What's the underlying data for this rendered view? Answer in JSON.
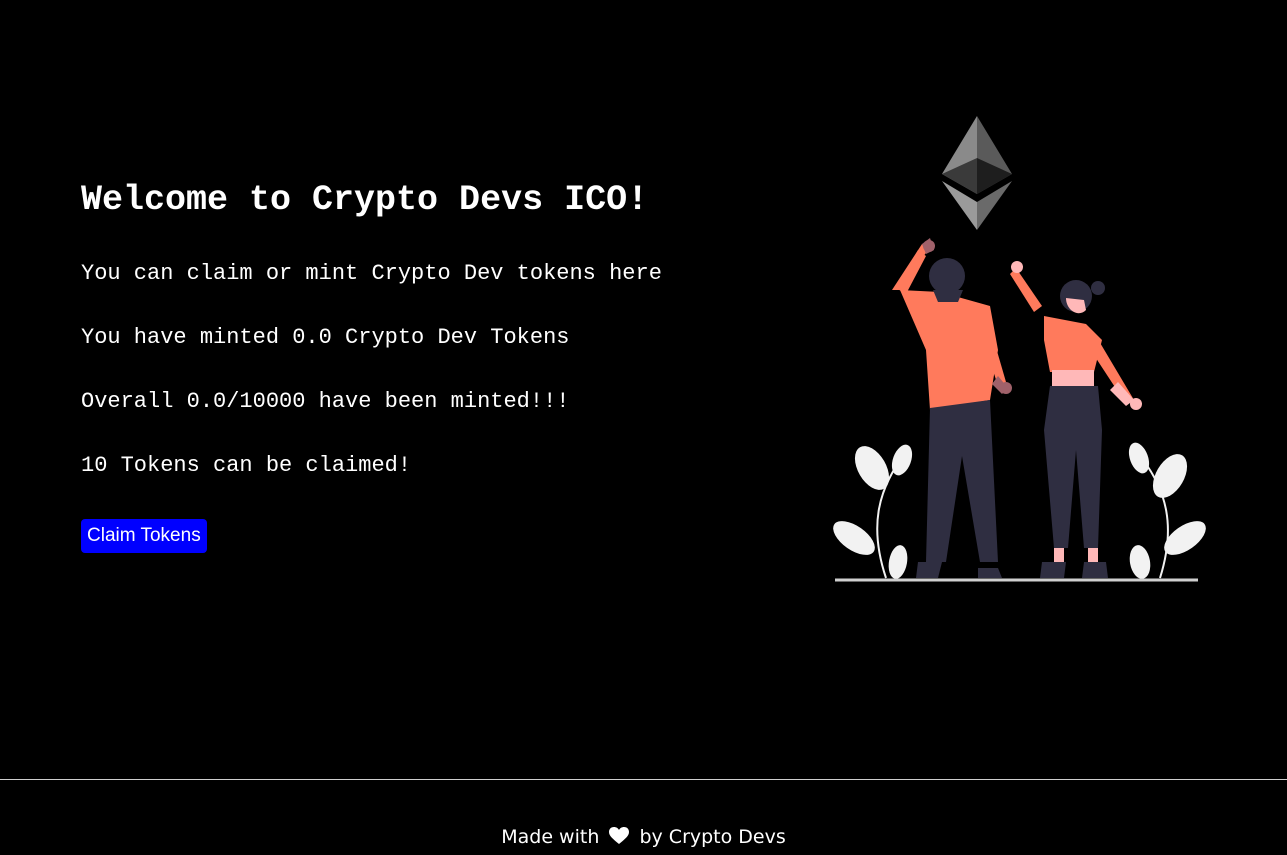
{
  "main": {
    "title": "Welcome to Crypto Devs ICO!",
    "description": "You can claim or mint Crypto Dev tokens here",
    "minted_text": "You have minted 0.0 Crypto Dev Tokens",
    "overall_text": "Overall 0.0/10000 have been minted!!!",
    "claimable_text": "10 Tokens can be claimed!",
    "claim_button_label": "Claim Tokens"
  },
  "illustration": {
    "icon": "ethereum-logo-icon"
  },
  "footer": {
    "prefix": "Made with",
    "icon": "heart-icon",
    "suffix": "by Crypto Devs"
  },
  "colors": {
    "background": "#000000",
    "text": "#ffffff",
    "button": "#0000ff",
    "accent_shirt": "#ff7a5c",
    "pants": "#2f2e41"
  }
}
